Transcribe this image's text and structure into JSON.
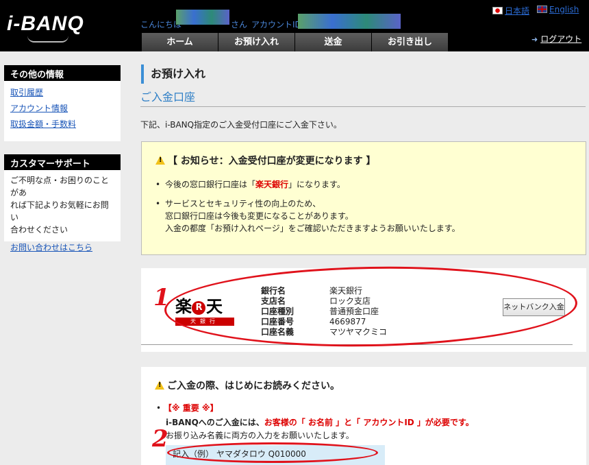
{
  "header": {
    "logo": "i-BANQ",
    "greeting_prefix": "こんにちは",
    "greeting_suffix": "さん",
    "account_id_label": "アカウントID ：",
    "lang_ja": "日本語",
    "lang_en": "English",
    "logout": "ログアウト",
    "nav": [
      "ホーム",
      "お預け入れ",
      "送金",
      "お引き出し"
    ]
  },
  "sidebar": {
    "info_title": "その他の情報",
    "info_links": [
      "取引履歴",
      "アカウント情報",
      "取扱金額・手数料"
    ],
    "support_title": "カスタマーサポート",
    "support_text": [
      "ご不明な点・お困りのことがあ",
      "れば下記よりお気軽にお問い",
      "合わせください"
    ],
    "support_link": "お問い合わせはこちら"
  },
  "main": {
    "page_title": "お預け入れ",
    "section_title": "ご入金口座",
    "intro": "下記、i-BANQ指定のご入金受付口座にご入金下さい。",
    "notice": {
      "title": "【 お知らせ：入金受付口座が変更になります 】",
      "item1_pre": "今後の窓口銀行口座は「",
      "item1_bank": "楽天銀行",
      "item1_post": "」になります。",
      "item2_lines": [
        "サービスとセキュリティ性の向上のため、",
        "窓口銀行口座は今後も変更になることがあります。",
        "入金の都度「お預け入れページ」をご確認いただきますようお願いいたします。"
      ]
    },
    "bank": {
      "logo_main_left": "楽",
      "logo_r": "R",
      "logo_main_right": "天",
      "logo_sub": "天銀行",
      "rows": [
        {
          "key": "銀行名",
          "value": "楽天銀行"
        },
        {
          "key": "支店名",
          "value": "ロック支店"
        },
        {
          "key": "口座種別",
          "value": "普通預金口座"
        },
        {
          "key": "口座番号",
          "value": "4669877"
        },
        {
          "key": "口座名義",
          "value": "マツヤマクミコ"
        }
      ],
      "netbank_button": "ネットバンク入金"
    },
    "read": {
      "title": "ご入金の際、はじめにお読みください。",
      "important": "【※ 重要 ※】",
      "line1_pre": "i-BANQへのご入金には、",
      "line1_red": "お客様の「 お名前 」と「 アカウントID 」が必要です。",
      "line2": "お振り込み名義に両方の入力をお願いいたします。",
      "example": "記入（例）  ヤマダタロウ   Q010000"
    }
  },
  "annotations": [
    "1",
    "2"
  ],
  "colors": {
    "accent_blue": "#2f7fc6",
    "annotation_red": "#e0121b",
    "notice_bg": "#ffffd2"
  }
}
